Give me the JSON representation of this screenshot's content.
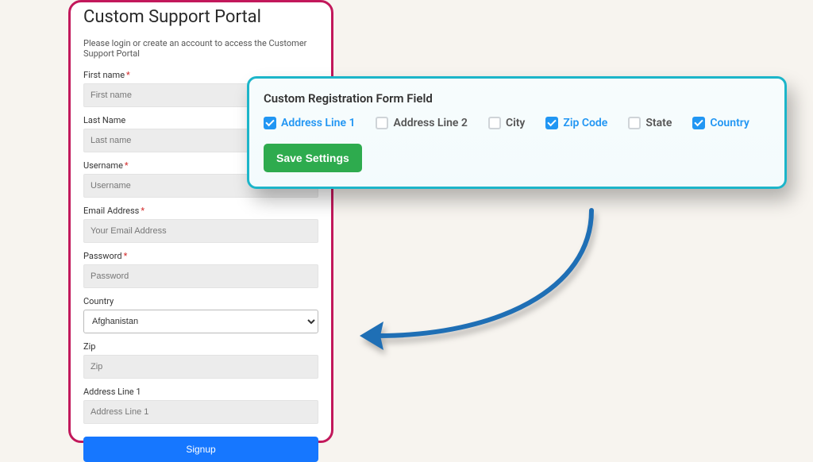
{
  "portal": {
    "title": "Custom Support Portal",
    "subtitle": "Please login or create an account to access the Customer Support Portal",
    "fields": [
      {
        "label": "First name",
        "required": true,
        "placeholder": "First name",
        "type": "text"
      },
      {
        "label": "Last Name",
        "required": false,
        "placeholder": "Last name",
        "type": "text"
      },
      {
        "label": "Username",
        "required": true,
        "placeholder": "Username",
        "type": "text"
      },
      {
        "label": "Email Address",
        "required": true,
        "placeholder": "Your Email Address",
        "type": "text"
      },
      {
        "label": "Password",
        "required": true,
        "placeholder": "Password",
        "type": "text"
      },
      {
        "label": "Country",
        "required": false,
        "value": "Afghanistan",
        "type": "select"
      },
      {
        "label": "Zip",
        "required": false,
        "placeholder": "Zip",
        "type": "text"
      },
      {
        "label": "Address Line 1",
        "required": false,
        "placeholder": "Address Line 1",
        "type": "text"
      }
    ],
    "signup_label": "Signup"
  },
  "settings": {
    "title": "Custom Registration Form Field",
    "options": [
      {
        "label": "Address Line 1",
        "checked": true
      },
      {
        "label": "Address Line 2",
        "checked": false
      },
      {
        "label": "City",
        "checked": false
      },
      {
        "label": "Zip Code",
        "checked": true
      },
      {
        "label": "State",
        "checked": false
      },
      {
        "label": "Country",
        "checked": true
      }
    ],
    "save_label": "Save Settings"
  }
}
